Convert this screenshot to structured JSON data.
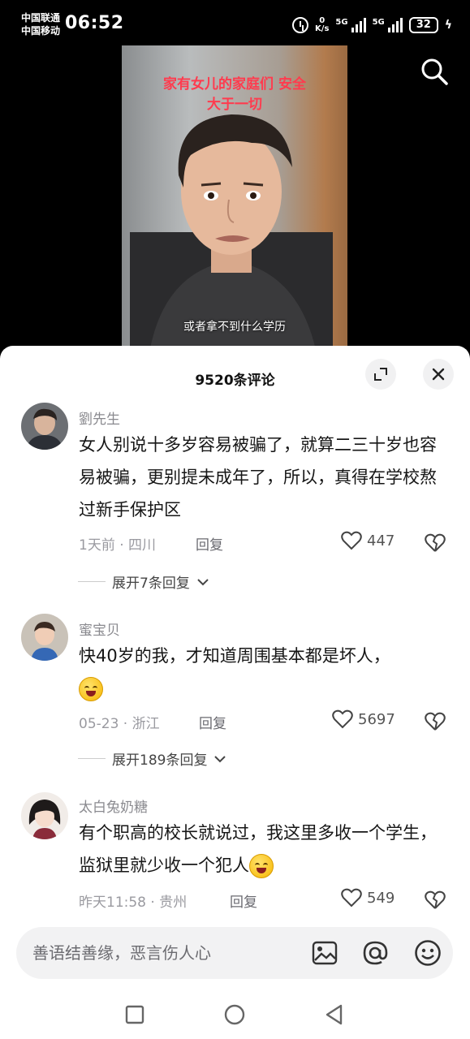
{
  "status_bar": {
    "carrier_1": "中国联通",
    "carrier_2": "中国移动",
    "time": "06:52",
    "net_speed_value": "0",
    "net_speed_unit": "K/s",
    "signal_1": "5G",
    "signal_2": "5G",
    "battery": "32"
  },
  "video": {
    "title_line1": "家有女儿的家庭们 安全",
    "title_line2": "大于一切",
    "subtitle": "或者拿不到什么学历",
    "title_color": "#ff3b4e"
  },
  "comments_panel": {
    "title": "9520条评论",
    "comments": [
      {
        "name": "劉先生",
        "text": "女人别说十多岁容易被骗了，就算二三十岁也容易被骗，更别提未成年了，所以，真得在学校熬过新手保护区",
        "meta": "1天前 · 四川",
        "reply": "回复",
        "likes": "447",
        "expand": "展开7条回复"
      },
      {
        "name": "蜜宝贝",
        "text": "快40岁的我，才知道周围基本都是坏人，",
        "meta": "05-23 · 浙江",
        "reply": "回复",
        "likes": "5697",
        "expand": "展开189条回复"
      },
      {
        "name": "太白兔奶糖",
        "text": "有个职高的校长就说过，我这里多收一个学生，监狱里就少收一个犯人",
        "meta": "昨天11:58 · 贵州",
        "reply": "回复",
        "likes": "549"
      }
    ]
  },
  "input": {
    "placeholder": "善语结善缘，恶言伤人心"
  },
  "icons": [
    "search-icon",
    "expand-icon",
    "close-icon",
    "heart-icon",
    "broken-heart-icon",
    "chevron-down-icon",
    "image-icon",
    "at-icon",
    "emoji-icon",
    "nav-square-icon",
    "nav-circle-icon",
    "nav-back-icon"
  ]
}
